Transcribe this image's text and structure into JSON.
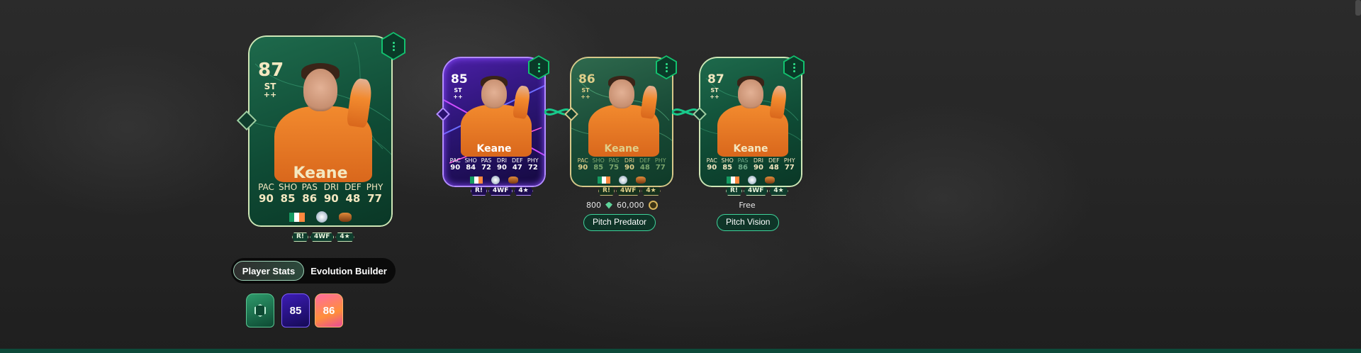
{
  "main_card": {
    "rating": "87",
    "position": "ST",
    "plus": "++",
    "name": "Keane",
    "stats": [
      {
        "label": "PAC",
        "value": "90"
      },
      {
        "label": "SHO",
        "value": "85"
      },
      {
        "label": "PAS",
        "value": "86"
      },
      {
        "label": "DRI",
        "value": "90"
      },
      {
        "label": "DEF",
        "value": "48"
      },
      {
        "label": "PHY",
        "value": "77"
      }
    ],
    "chem": [
      "R!",
      "4WF",
      "4★"
    ]
  },
  "evo_cards": [
    {
      "rating": "85",
      "position": "ST",
      "plus": "++",
      "name": "Keane",
      "stats": [
        {
          "label": "PAC",
          "value": "90"
        },
        {
          "label": "SHO",
          "value": "84"
        },
        {
          "label": "PAS",
          "value": "72"
        },
        {
          "label": "DRI",
          "value": "90"
        },
        {
          "label": "DEF",
          "value": "47"
        },
        {
          "label": "PHY",
          "value": "72"
        }
      ],
      "chem": [
        "R!",
        "4WF",
        "4★"
      ]
    },
    {
      "rating": "86",
      "position": "ST",
      "plus": "++",
      "name": "Keane",
      "stats": [
        {
          "label": "PAC",
          "value": "90"
        },
        {
          "label": "SHO",
          "value": "85"
        },
        {
          "label": "PAS",
          "value": "75"
        },
        {
          "label": "DRI",
          "value": "90"
        },
        {
          "label": "DEF",
          "value": "48"
        },
        {
          "label": "PHY",
          "value": "77"
        }
      ],
      "chem": [
        "R!",
        "4WF",
        "4★"
      ],
      "cost": {
        "points": "800",
        "coins": "60,000"
      },
      "evolution_name": "Pitch Predator"
    },
    {
      "rating": "87",
      "position": "ST",
      "plus": "++",
      "name": "Keane",
      "stats": [
        {
          "label": "PAC",
          "value": "90"
        },
        {
          "label": "SHO",
          "value": "85"
        },
        {
          "label": "PAS",
          "value": "86"
        },
        {
          "label": "DRI",
          "value": "90"
        },
        {
          "label": "DEF",
          "value": "48"
        },
        {
          "label": "PHY",
          "value": "77"
        }
      ],
      "chem": [
        "R!",
        "4WF",
        "4★"
      ],
      "cost_label": "Free",
      "evolution_name": "Pitch Vision"
    }
  ],
  "toggle": {
    "active": "Player Stats",
    "inactive": "Evolution Builder"
  },
  "versions": [
    {
      "label": "",
      "icon": "evolution-icon"
    },
    {
      "label": "85"
    },
    {
      "label": "86"
    }
  ],
  "colors": {
    "accent": "#2de28a",
    "card_green": "#0f4b35",
    "card_purple": "#2c1575",
    "card_gold": "#d7c88a",
    "button_border": "#3fd39b"
  }
}
